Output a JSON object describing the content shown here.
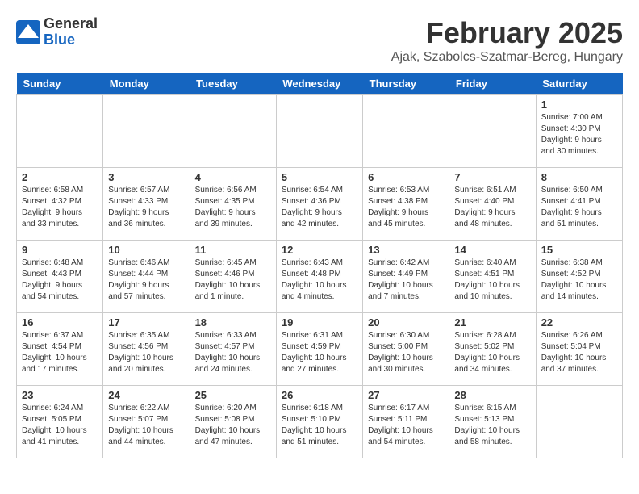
{
  "header": {
    "logo_general": "General",
    "logo_blue": "Blue",
    "title": "February 2025",
    "location": "Ajak, Szabolcs-Szatmar-Bereg, Hungary"
  },
  "calendar": {
    "days_of_week": [
      "Sunday",
      "Monday",
      "Tuesday",
      "Wednesday",
      "Thursday",
      "Friday",
      "Saturday"
    ],
    "weeks": [
      [
        {
          "day": "",
          "info": ""
        },
        {
          "day": "",
          "info": ""
        },
        {
          "day": "",
          "info": ""
        },
        {
          "day": "",
          "info": ""
        },
        {
          "day": "",
          "info": ""
        },
        {
          "day": "",
          "info": ""
        },
        {
          "day": "1",
          "info": "Sunrise: 7:00 AM\nSunset: 4:30 PM\nDaylight: 9 hours and 30 minutes."
        }
      ],
      [
        {
          "day": "2",
          "info": "Sunrise: 6:58 AM\nSunset: 4:32 PM\nDaylight: 9 hours and 33 minutes."
        },
        {
          "day": "3",
          "info": "Sunrise: 6:57 AM\nSunset: 4:33 PM\nDaylight: 9 hours and 36 minutes."
        },
        {
          "day": "4",
          "info": "Sunrise: 6:56 AM\nSunset: 4:35 PM\nDaylight: 9 hours and 39 minutes."
        },
        {
          "day": "5",
          "info": "Sunrise: 6:54 AM\nSunset: 4:36 PM\nDaylight: 9 hours and 42 minutes."
        },
        {
          "day": "6",
          "info": "Sunrise: 6:53 AM\nSunset: 4:38 PM\nDaylight: 9 hours and 45 minutes."
        },
        {
          "day": "7",
          "info": "Sunrise: 6:51 AM\nSunset: 4:40 PM\nDaylight: 9 hours and 48 minutes."
        },
        {
          "day": "8",
          "info": "Sunrise: 6:50 AM\nSunset: 4:41 PM\nDaylight: 9 hours and 51 minutes."
        }
      ],
      [
        {
          "day": "9",
          "info": "Sunrise: 6:48 AM\nSunset: 4:43 PM\nDaylight: 9 hours and 54 minutes."
        },
        {
          "day": "10",
          "info": "Sunrise: 6:46 AM\nSunset: 4:44 PM\nDaylight: 9 hours and 57 minutes."
        },
        {
          "day": "11",
          "info": "Sunrise: 6:45 AM\nSunset: 4:46 PM\nDaylight: 10 hours and 1 minute."
        },
        {
          "day": "12",
          "info": "Sunrise: 6:43 AM\nSunset: 4:48 PM\nDaylight: 10 hours and 4 minutes."
        },
        {
          "day": "13",
          "info": "Sunrise: 6:42 AM\nSunset: 4:49 PM\nDaylight: 10 hours and 7 minutes."
        },
        {
          "day": "14",
          "info": "Sunrise: 6:40 AM\nSunset: 4:51 PM\nDaylight: 10 hours and 10 minutes."
        },
        {
          "day": "15",
          "info": "Sunrise: 6:38 AM\nSunset: 4:52 PM\nDaylight: 10 hours and 14 minutes."
        }
      ],
      [
        {
          "day": "16",
          "info": "Sunrise: 6:37 AM\nSunset: 4:54 PM\nDaylight: 10 hours and 17 minutes."
        },
        {
          "day": "17",
          "info": "Sunrise: 6:35 AM\nSunset: 4:56 PM\nDaylight: 10 hours and 20 minutes."
        },
        {
          "day": "18",
          "info": "Sunrise: 6:33 AM\nSunset: 4:57 PM\nDaylight: 10 hours and 24 minutes."
        },
        {
          "day": "19",
          "info": "Sunrise: 6:31 AM\nSunset: 4:59 PM\nDaylight: 10 hours and 27 minutes."
        },
        {
          "day": "20",
          "info": "Sunrise: 6:30 AM\nSunset: 5:00 PM\nDaylight: 10 hours and 30 minutes."
        },
        {
          "day": "21",
          "info": "Sunrise: 6:28 AM\nSunset: 5:02 PM\nDaylight: 10 hours and 34 minutes."
        },
        {
          "day": "22",
          "info": "Sunrise: 6:26 AM\nSunset: 5:04 PM\nDaylight: 10 hours and 37 minutes."
        }
      ],
      [
        {
          "day": "23",
          "info": "Sunrise: 6:24 AM\nSunset: 5:05 PM\nDaylight: 10 hours and 41 minutes."
        },
        {
          "day": "24",
          "info": "Sunrise: 6:22 AM\nSunset: 5:07 PM\nDaylight: 10 hours and 44 minutes."
        },
        {
          "day": "25",
          "info": "Sunrise: 6:20 AM\nSunset: 5:08 PM\nDaylight: 10 hours and 47 minutes."
        },
        {
          "day": "26",
          "info": "Sunrise: 6:18 AM\nSunset: 5:10 PM\nDaylight: 10 hours and 51 minutes."
        },
        {
          "day": "27",
          "info": "Sunrise: 6:17 AM\nSunset: 5:11 PM\nDaylight: 10 hours and 54 minutes."
        },
        {
          "day": "28",
          "info": "Sunrise: 6:15 AM\nSunset: 5:13 PM\nDaylight: 10 hours and 58 minutes."
        },
        {
          "day": "",
          "info": ""
        }
      ]
    ]
  }
}
